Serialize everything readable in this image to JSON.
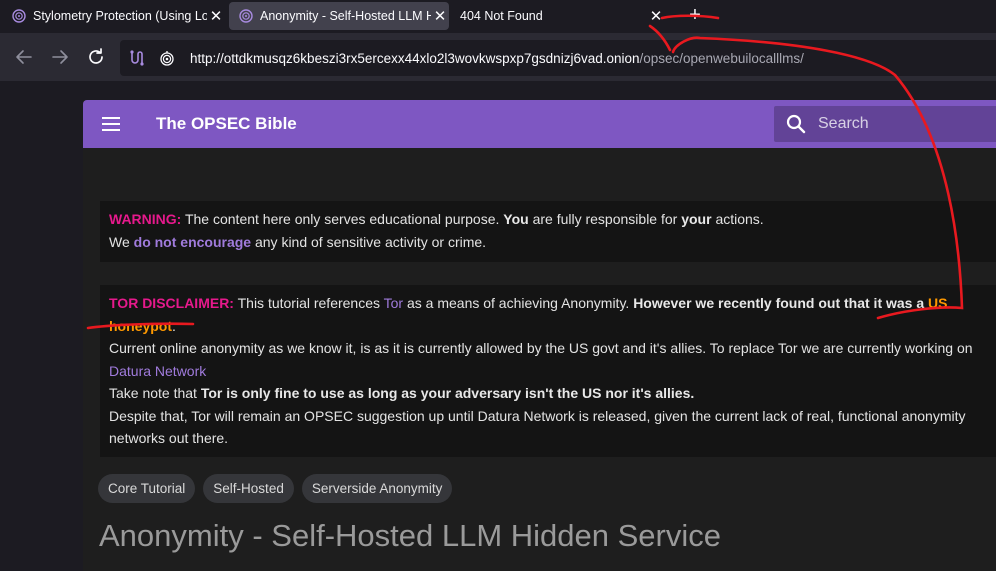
{
  "browser": {
    "tabs": [
      {
        "title": "Stylometry Protection (Using Lo",
        "close": "✕",
        "active": false
      },
      {
        "title": "Anonymity - Self-Hosted LLM H",
        "close": "✕",
        "active": true
      },
      {
        "title": "404 Not Found",
        "close": "✕",
        "active": false
      }
    ],
    "new_tab": "+",
    "url_host": "http://ottdkmusqz6kbeszi3rx5ercexx44xlo2l3wovkwspxp7gsdnizj6vad.onion",
    "url_path": "/opsec/openwebuilocalllms/"
  },
  "site": {
    "title": "The OPSEC Bible",
    "search_placeholder": "Search"
  },
  "warning": {
    "label": "WARNING:",
    "t1": " The content here only serves educational purpose. ",
    "you": "You",
    "t2": " are fully responsible for ",
    "your": "your",
    "t3": " actions.",
    "t4": "We ",
    "dne": "do not encourage",
    "t5": " any kind of sensitive activity or crime."
  },
  "tor": {
    "label": "TOR DISCLAIMER:",
    "t1": " This tutorial references ",
    "tor_link": "Tor",
    "t2": " as a means of achieving Anonymity. ",
    "bold1": "However we recently found out that it was a ",
    "us": "US",
    "honeypot": "honeypot",
    "period": ".",
    "line2": "Current online anonymity as we know it, is as it is currently allowed by the US govt and it's allies. To replace Tor we are currently working on",
    "datura": "Datura Network",
    "t3": "Take note that ",
    "bold2": "Tor is only fine to use as long as your adversary isn't the US nor it's allies.",
    "line4": "Despite that, Tor will remain an OPSEC suggestion up until Datura Network is released, given the current lack of real, functional anonymity networks out there."
  },
  "tags": [
    "Core Tutorial",
    "Self-Hosted",
    "Serverside Anonymity"
  ],
  "page_heading": "Anonymity - Self-Hosted LLM Hidden Service",
  "icons": {
    "tab_favicon": "onion-logo-icon",
    "back": "arrow-left-icon",
    "forward": "arrow-right-icon",
    "reload": "reload-icon",
    "url_extension": "extension-icon",
    "onion": "onion-icon",
    "menu": "hamburger-menu-icon",
    "search": "search-icon"
  },
  "colors": {
    "header_purple": "#7e57c2",
    "warning_pink": "#e6198c",
    "highlight_orange": "#ff9900",
    "link_purple": "#a07bdc",
    "annotation_red": "#e8191f"
  }
}
